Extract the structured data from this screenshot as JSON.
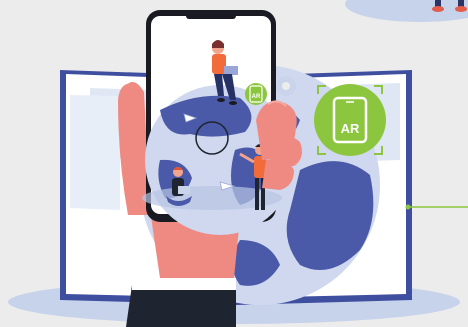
{
  "illustration": {
    "ar_badge_large": "AR",
    "ar_badge_small": "AR"
  },
  "colors": {
    "background": "#ececec",
    "ground_shadow": "#c7d3ea",
    "book_cover": "#3f4fa0",
    "book_page": "#ffffff",
    "page_tint": "#dfe7f5",
    "globe_land": "#4a5aa8",
    "globe_sea": "#cfd8ee",
    "ar_green": "#8cc63f",
    "phone_frame": "#1a1a22",
    "hand_skin": "#ef8a82",
    "sleeve": "#1f2431",
    "person_orange": "#f26b3a"
  }
}
